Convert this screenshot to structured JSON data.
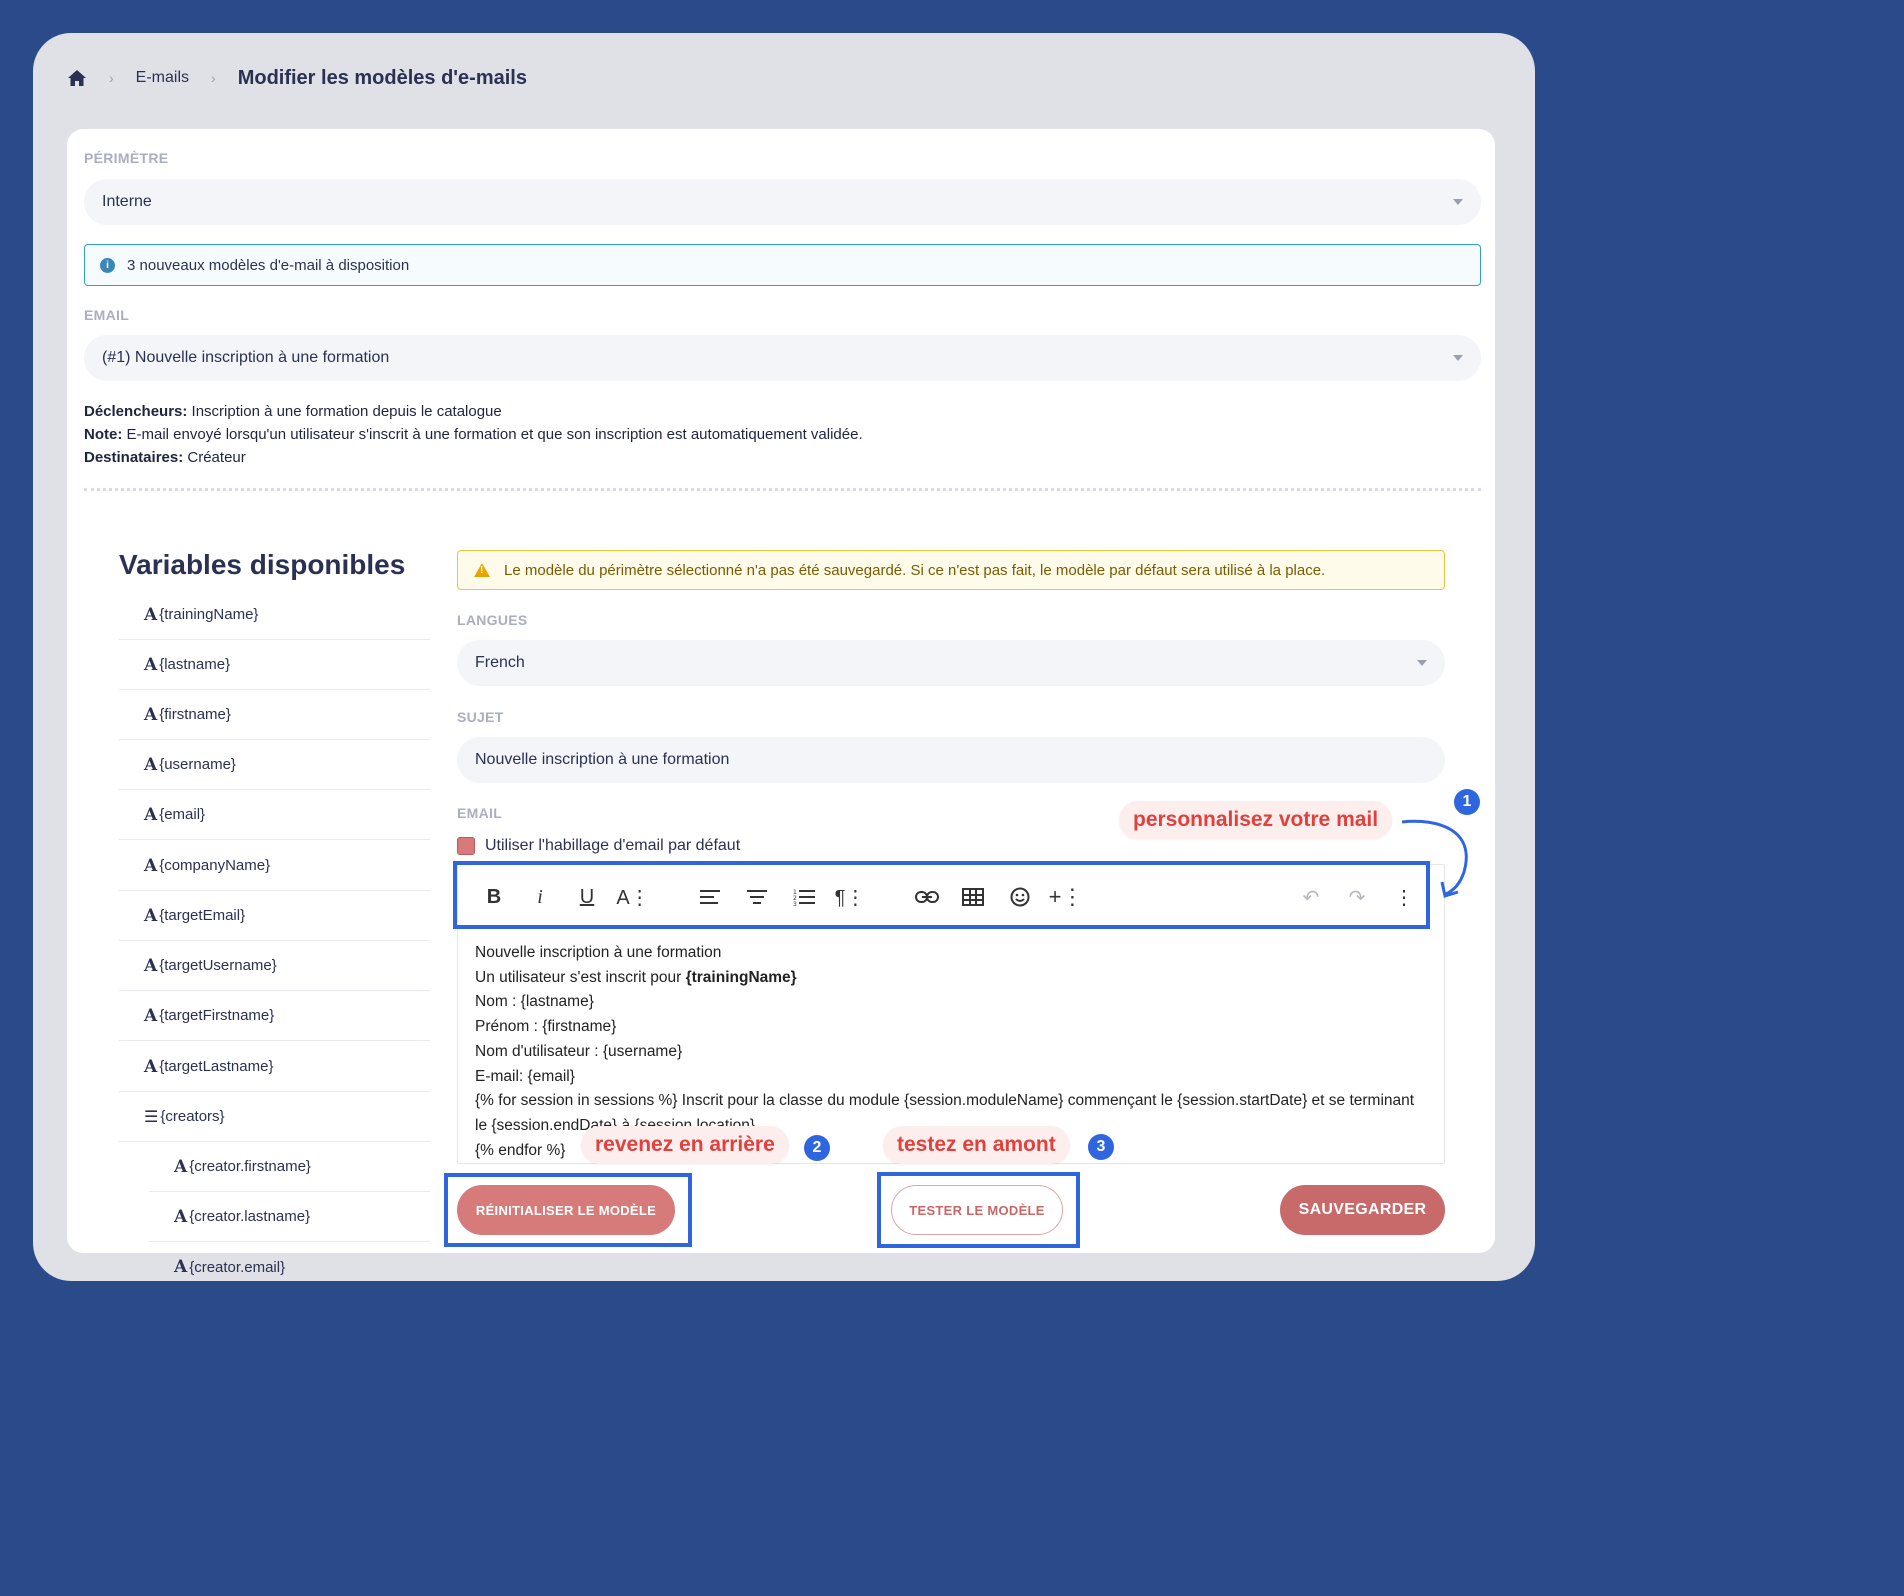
{
  "breadcrumb": {
    "item1": "E-mails",
    "title": "Modifier les modèles d'e-mails"
  },
  "perimetre": {
    "label": "PÉRIMÈTRE",
    "value": "Interne"
  },
  "info_banner": {
    "text": "3 nouveaux modèles d'e-mail à disposition"
  },
  "email_select": {
    "label": "EMAIL",
    "value": "(#1) Nouvelle inscription à une formation"
  },
  "details": {
    "triggers_label": "Déclencheurs:",
    "triggers": "Inscription à une formation depuis le catalogue",
    "note_label": "Note:",
    "note": "E-mail envoyé lorsqu'un utilisateur s'inscrit à une formation et que son inscription est automatiquement validée.",
    "recipients_label": "Destinataires:",
    "recipients": "Créateur"
  },
  "variables": {
    "title": "Variables disponibles",
    "items": [
      "{trainingName}",
      "{lastname}",
      "{firstname}",
      "{username}",
      "{email}",
      "{companyName}",
      "{targetEmail}",
      "{targetUsername}",
      "{targetFirstname}",
      "{targetLastname}",
      "{creators}",
      "{creator.firstname}",
      "{creator.lastname}",
      "{creator.email}"
    ]
  },
  "warning": {
    "text": "Le modèle du périmètre sélectionné n'a pas été sauvegardé. Si ce n'est pas fait, le modèle par défaut sera utilisé à la place."
  },
  "langues": {
    "label": "LANGUES",
    "value": "French"
  },
  "sujet": {
    "label": "SUJET",
    "value": "Nouvelle inscription à une formation"
  },
  "email_editor": {
    "label": "EMAIL",
    "checkbox_label": "Utiliser l'habillage d'email par défaut",
    "lines": [
      "Nouvelle inscription à une formation",
      "Un utilisateur s'est inscrit pour ",
      "{trainingName}",
      "Nom : {lastname}",
      "Prénom : {firstname}",
      "Nom d'utilisateur : {username}",
      "E-mail: {email}",
      "{% for session in sessions %} Inscrit pour la classe du module {session.moduleName} commençant le {session.startDate} et se terminant le {session.endDate} à {session.location}.",
      "{% endfor %}"
    ]
  },
  "toolbar": {
    "icons": [
      "bold-icon",
      "italic-icon",
      "underline-icon",
      "font-size-icon",
      "align-left-icon",
      "align-center-icon",
      "ordered-list-icon",
      "paragraph-icon",
      "link-icon",
      "table-icon",
      "emoji-icon",
      "insert-icon",
      "undo-icon",
      "redo-icon",
      "more-icon"
    ]
  },
  "buttons": {
    "reset": "RÉINITIALISER LE MODÈLE",
    "test": "TESTER LE MODÈLE",
    "save": "SAUVEGARDER"
  },
  "annotations": {
    "note1": "personnalisez votre mail",
    "num1": "1",
    "note2": "revenez en arrière",
    "num2": "2",
    "note3": "testez en amont",
    "num3": "3",
    "highlight_color": "#2f66e0"
  }
}
